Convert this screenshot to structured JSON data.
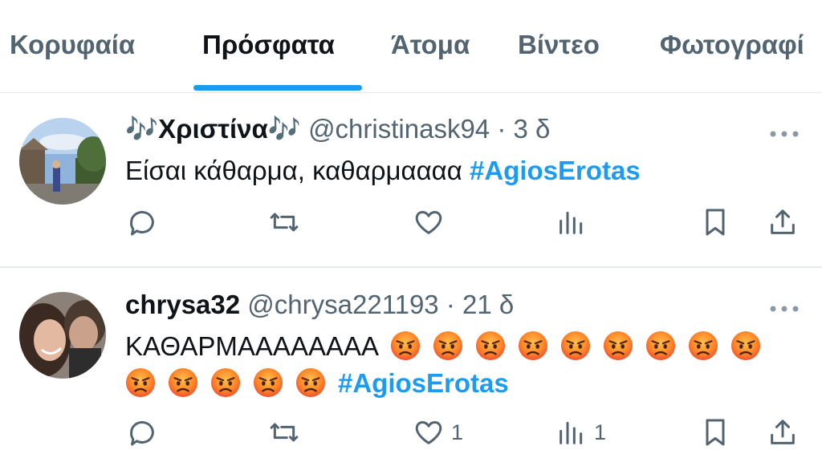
{
  "tabs": [
    {
      "label": "Κορυφαία"
    },
    {
      "label": "Πρόσφατα"
    },
    {
      "label": "Άτομα"
    },
    {
      "label": "Βίντεο"
    },
    {
      "label": "Φωτογραφί"
    }
  ],
  "active_tab": "Πρόσφατα",
  "colors": {
    "accent": "#1d9bf0",
    "text": "#0f1419",
    "muted": "#536471",
    "divider": "#e6e9ec"
  },
  "tweets": [
    {
      "display_name": "🎶Χριστίνα🎶",
      "handle": "@christinask94",
      "separator": "·",
      "time": "3 δ",
      "text": "Είσαι κάθαρμα, καθαρμαααα",
      "hashtag": "#AgiosErotas",
      "like_count": "",
      "views_count": ""
    },
    {
      "display_name": "chrysa32",
      "handle": "@chrysa221193",
      "separator": "·",
      "time": "21 δ",
      "text": "ΚΑΘΑΡΜΑΑΑΑΑΑΑΑ",
      "emoji_line1_count": 9,
      "emoji_line2_count": 5,
      "emoji": "pouting-face-icon",
      "hashtag": "#AgiosErotas",
      "like_count": "1",
      "views_count": "1"
    }
  ],
  "icons": [
    "reply-icon",
    "retweet-icon",
    "like-icon",
    "views-icon",
    "bookmark-icon",
    "share-icon",
    "more-icon"
  ]
}
